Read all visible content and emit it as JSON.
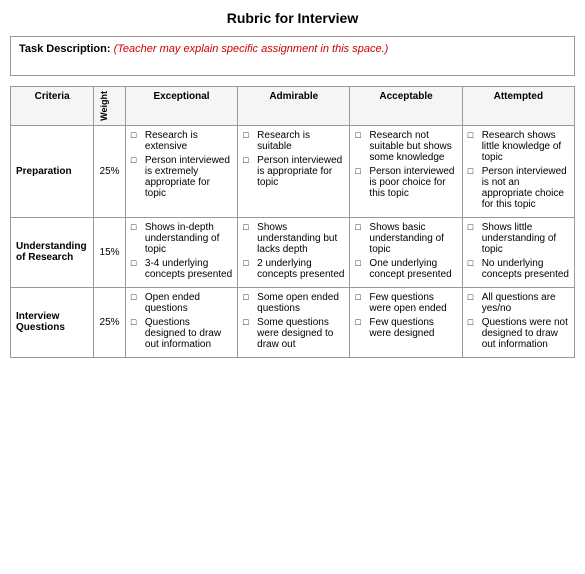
{
  "title": "Rubric for Interview",
  "task": {
    "label": "Task Description:",
    "value": "(Teacher may explain specific assignment in this space.)"
  },
  "table": {
    "headers": {
      "criteria": "Criteria",
      "weight": "Weight",
      "exceptional": "Exceptional",
      "admirable": "Admirable",
      "acceptable": "Acceptable",
      "attempted": "Attempted"
    },
    "rows": [
      {
        "criteria": "Preparation",
        "weight": "25%",
        "exceptional": [
          "Research is extensive",
          "Person interviewed is extremely appropriate for topic"
        ],
        "admirable": [
          "Research is suitable",
          "Person interviewed is appropriate for topic"
        ],
        "acceptable": [
          "Research not suitable but shows some knowledge",
          "Person interviewed is poor choice for this topic"
        ],
        "attempted": [
          "Research shows little knowledge of topic",
          "Person interviewed is not an appropriate choice for this topic"
        ]
      },
      {
        "criteria": "Understanding of Research",
        "weight": "15%",
        "exceptional": [
          "Shows in-depth understanding of topic",
          "3-4 underlying concepts presented"
        ],
        "admirable": [
          "Shows understanding but lacks depth",
          "2 underlying concepts presented"
        ],
        "acceptable": [
          "Shows basic understanding of topic",
          "One underlying concept presented"
        ],
        "attempted": [
          "Shows little understanding of topic",
          "No underlying concepts presented"
        ]
      },
      {
        "criteria": "Interview Questions",
        "weight": "25%",
        "exceptional": [
          "Open ended questions",
          "Questions designed to draw out information"
        ],
        "admirable": [
          "Some open ended questions",
          "Some questions were designed to draw out"
        ],
        "acceptable": [
          "Few questions were open ended",
          "Few questions were designed"
        ],
        "attempted": [
          "All questions are yes/no",
          "Questions were not designed to draw out information"
        ]
      }
    ]
  }
}
